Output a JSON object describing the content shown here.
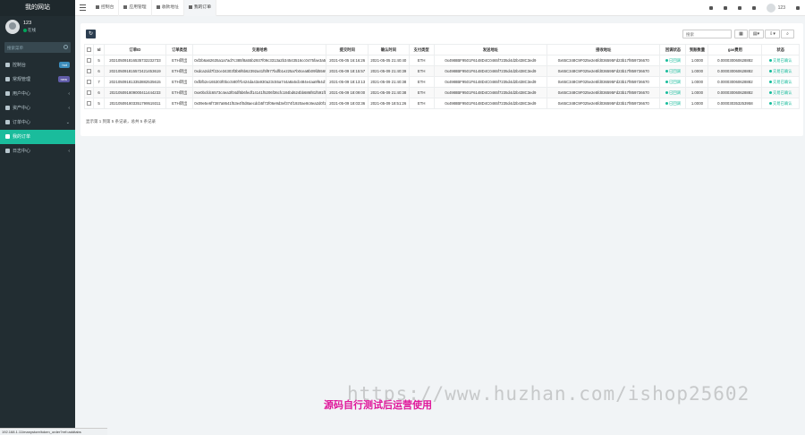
{
  "sidebar": {
    "brand": "我的网站",
    "user": {
      "name": "123",
      "status": "在线"
    },
    "search_placeholder": "搜索菜单",
    "items": [
      {
        "label": "控制台",
        "icon": "dashboard-icon",
        "badge": "hot",
        "badge_color": "#3c8dbc"
      },
      {
        "label": "常规管理",
        "icon": "gear-icon",
        "badge": "new",
        "badge_color": "#605ca8"
      },
      {
        "label": "用户中心",
        "icon": "users-icon",
        "chevron": "‹"
      },
      {
        "label": "资产中心",
        "icon": "wallet-icon",
        "chevron": "‹"
      },
      {
        "label": "订单中心",
        "icon": "orders-icon",
        "chevron": "⌄"
      },
      {
        "label": "我的订单",
        "icon": "list-icon",
        "active": true
      },
      {
        "label": "日志中心",
        "icon": "log-icon",
        "chevron": "‹"
      }
    ],
    "status_url": "192.168.1.11/manystore/token_order?ref=addtabs"
  },
  "topbar": {
    "tabs": [
      {
        "label": "控制台",
        "icon": "dashboard-icon"
      },
      {
        "label": "应用管理",
        "icon": "app-icon"
      },
      {
        "label": "收款地址",
        "icon": "address-icon"
      },
      {
        "label": "我的订单",
        "icon": "list-icon",
        "active": true
      }
    ],
    "user": "123"
  },
  "toolbar": {
    "search_placeholder": "搜索",
    "refresh_icon": "refresh-icon"
  },
  "table": {
    "headers": [
      "",
      "Id",
      "订单ID",
      "订单类型",
      "交易哈希",
      "提交时间",
      "确认时间",
      "支付类型",
      "发送地址",
      "接收地址",
      "回调状态",
      "到账数量",
      "gas费用",
      "状态"
    ],
    "rows": [
      [
        "",
        "5",
        "202105091816535732232733",
        "ETH转出",
        "0xf2b6a62635a1a7ad7c385f8a55b2937f09c3313a2b34543516cc0475fae3a5a",
        "2021-05-05 16:16:26",
        "2021-05-05 21:40:40",
        "ETH",
        "0x4988BF9501F6148D4C0465f7235d4d2b438C3ed9",
        "0x65C348C9F025e2e5fd036595Fd23b17f859736670",
        "已回调",
        "1.0000",
        "0.000030060628882",
        "交易已确认"
      ],
      [
        "",
        "6",
        "202105091815572421453619",
        "ETH转出",
        "0xdca2dd7f22ce34303f3b6f6b62392a41f5f977bdfb1e225a7b0cea8b09fd5569",
        "2021-05-09 18:15:57",
        "2021-05-09 21:40:39",
        "ETH",
        "0x4988BF9501F6148D4C0465f7235d4d2b438C3ed9",
        "0x65C348C9F025e2e5fd036595Fd23b17f859736670",
        "已回调",
        "1.0000",
        "0.000030060628882",
        "交易已确认"
      ],
      [
        "",
        "7",
        "202105091813353882535615",
        "ETH转出",
        "0xfbfb2e165303f0bcc580f7b424da43a930a23c55a744a8a5cb484e4aa9f64d78361",
        "2021-05-09 18:13:13",
        "2021-05-09 21:40:38",
        "ETH",
        "0x4988BF9501F6148D4C0465f7235d4d2b438C3ed9",
        "0x65C348C9F025e2e5fd036595Fd23b17f859736670",
        "已回调",
        "1.0000",
        "0.000030060628882",
        "交易已确认"
      ],
      [
        "",
        "6",
        "202105091809000411444233",
        "ETH转出",
        "0xe0bcfdc6573c4ea3f04df5b6fedf14141f5206f36cfc184bd624bb686f81f591fb50",
        "2021-05-09 18:09:00",
        "2021-05-09 21:40:38",
        "ETH",
        "0x4988BF9501F6148D4C0465f7235d4d2b438C3ed9",
        "0x65C348C9F025e2e5fd036595Fd23b17f859736670",
        "已回调",
        "1.0000",
        "0.000030060628882",
        "交易已确认"
      ],
      [
        "",
        "5",
        "202105091803351799519311",
        "ETH转出",
        "0x09e5e6f7387a8641f53e4f0d8aecdcb5f72f06e9d3ef374f1920ae8c8ea2d0f15",
        "2021-05-09 18:03:36",
        "2021-05-09 18:51:26",
        "ETH",
        "0x4988BF9501F6148D4C0465f7235d4d2b438C3ed9",
        "0x65C348C9F025e2e5fd036595Fd23b17f859736670",
        "已回调",
        "1.0000",
        "0.000030353253958",
        "交易已确认"
      ]
    ],
    "status_color": "#18bc9c"
  },
  "pager": "显示第 1 到第 5 条记录，总共 5 条记录",
  "watermark": {
    "url": "https://www.huzhan.com/ishop25602",
    "notice": "源码自行测试后运营使用"
  }
}
